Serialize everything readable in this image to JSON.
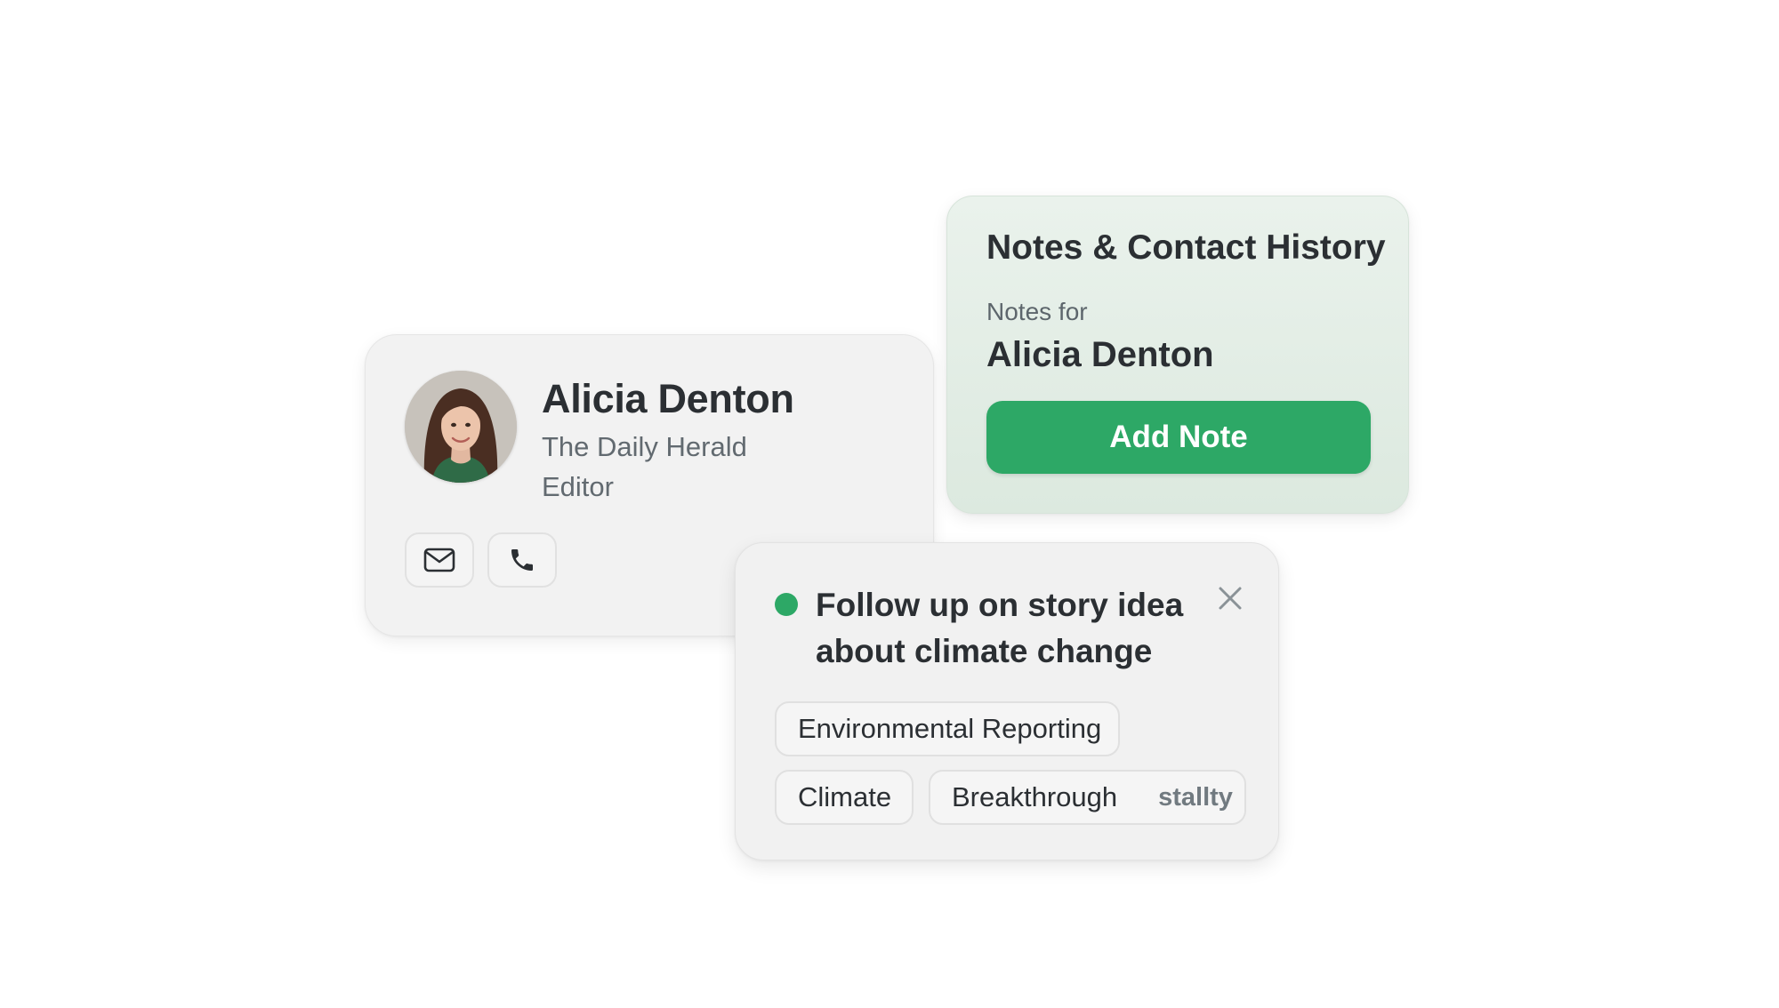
{
  "contact": {
    "name": "Alicia Denton",
    "organization": "The Daily Herald",
    "role": "Editor",
    "avatar_icon": "person-photo",
    "actions": [
      {
        "icon": "mail-icon"
      },
      {
        "icon": "phone-icon"
      }
    ]
  },
  "notes_panel": {
    "title": "Notes & Contact History",
    "subtitle": "Notes for",
    "contact_name": "Alicia Denton",
    "add_button_label": "Add Note"
  },
  "note_item": {
    "status_color": "#2da866",
    "text": "Follow up on story idea about climate change",
    "close_icon": "close-icon",
    "tags": [
      {
        "label": "Environmental Reporting"
      },
      {
        "label": "Climate"
      },
      {
        "label": "Breakthrough",
        "sub": "stallty"
      }
    ]
  },
  "colors": {
    "accent": "#2da866",
    "notes_panel_bg": "#e3eee6",
    "card_bg": "#f2f2f2",
    "text_primary": "#2b2f33",
    "text_secondary": "#626a70"
  }
}
